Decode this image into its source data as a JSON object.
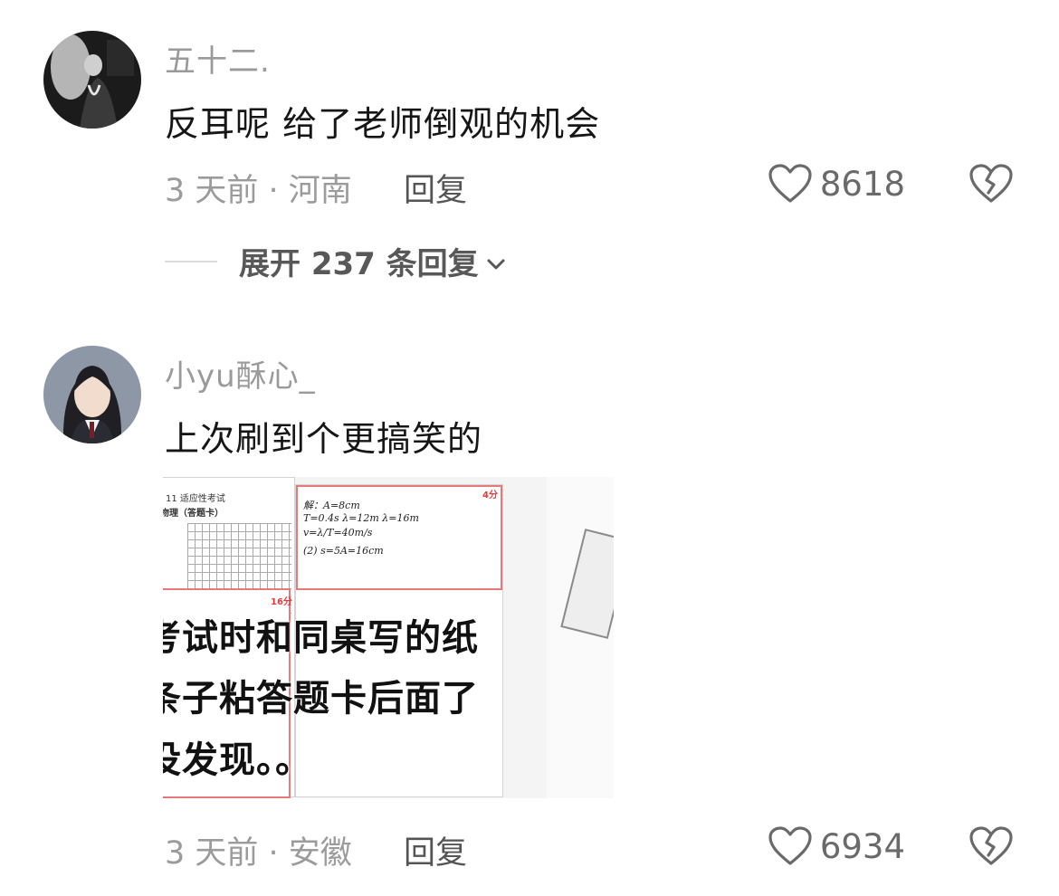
{
  "comments": [
    {
      "username": "五十二.",
      "text": "反耳呢 给了老师倒观的机会",
      "time_location": "3 天前 · 河南",
      "reply_label": "回复",
      "likes": "8618",
      "expand_label": "展开 237 条回复"
    },
    {
      "username": "小yu酥心_",
      "text": "上次刷到个更搞笑的",
      "time_location": "3 天前 · 安徽",
      "reply_label": "回复",
      "likes": "6934",
      "image": {
        "header": "11 适应性考试",
        "subheader": "物理（答题卡）",
        "score_a": "4分",
        "score_b": "16分",
        "caption_lines": [
          "考试时和同桌写的纸",
          "条子粘答题卡后面了",
          "没发现。。"
        ]
      }
    }
  ],
  "colors": {
    "meta_gray": "#9b9b9b",
    "text": "#161616",
    "score_red": "#e23b3b"
  },
  "icons": [
    "heart-outline-icon",
    "broken-heart-icon",
    "chevron-down-icon"
  ]
}
